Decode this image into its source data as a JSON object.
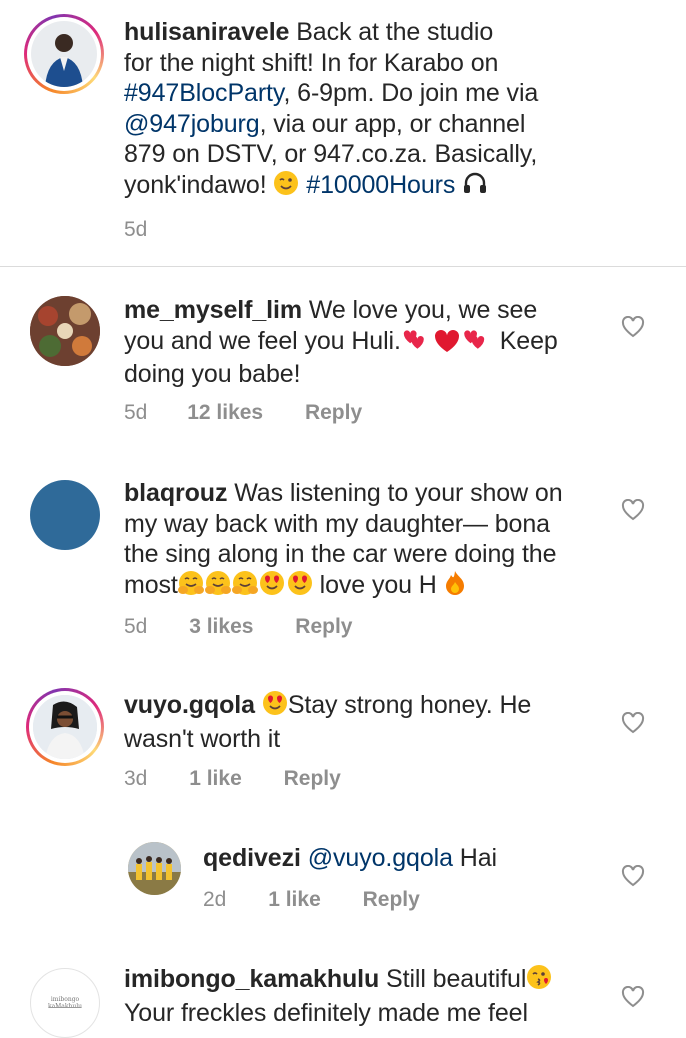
{
  "post": {
    "username": "hulisaniravele",
    "caption_line1": "Back at the studio",
    "caption_line2": "for the night shift! In for Karabo on",
    "hashtag1": "#947BlocParty",
    "caption_line3_rest": ", 6-9pm. Do join me via",
    "mention1": "@947joburg",
    "caption_line4_rest": ", via our app, or channel",
    "caption_line5": "879 on DSTV, or 947.co.za. Basically,",
    "caption_line6": "yonk'indawo!",
    "hashtag2": "#10000Hours",
    "time": "5d"
  },
  "comments": [
    {
      "username": "me_myself_lim",
      "line1": "We love you, we see",
      "line2a": "you and we feel you Huli.",
      "line2b": "Keep",
      "line3": "doing you babe!",
      "time": "5d",
      "likes": "12 likes",
      "reply": "Reply"
    },
    {
      "username": "blaqrouz",
      "line1": "Was listening to your show on",
      "line2": "my way back with my daughter— bona",
      "line3": "the sing along in the car were doing the",
      "line4a": "most",
      "line4b": "love you H",
      "time": "5d",
      "likes": "3 likes",
      "reply": "Reply"
    },
    {
      "username": "vuyo.gqola",
      "line1": "Stay strong honey. He",
      "line2": "wasn't worth it",
      "time": "3d",
      "likes": "1 like",
      "reply": "Reply"
    },
    {
      "username": "qedivezi",
      "mention": "@vuyo.gqola",
      "line1": "Hai",
      "time": "2d",
      "likes": "1 like",
      "reply": "Reply"
    },
    {
      "username": "imibongo_kamakhulu",
      "line1": "Still beautiful",
      "line2": "Your freckles definitely made me feel",
      "avatar_text": "imibongo kaMakhulu"
    }
  ],
  "colors": {
    "text": "#262626",
    "link": "#003569",
    "meta": "#8e8e8e",
    "blaqrouz_avatar": "#2f6a99"
  },
  "icons": [
    "heart-outline-icon",
    "wink-emoji-icon",
    "headphones-icon",
    "hearts-emoji-icon",
    "hug-emoji-icon",
    "heart-eyes-emoji-icon",
    "fire-emoji-icon",
    "kiss-emoji-icon"
  ]
}
